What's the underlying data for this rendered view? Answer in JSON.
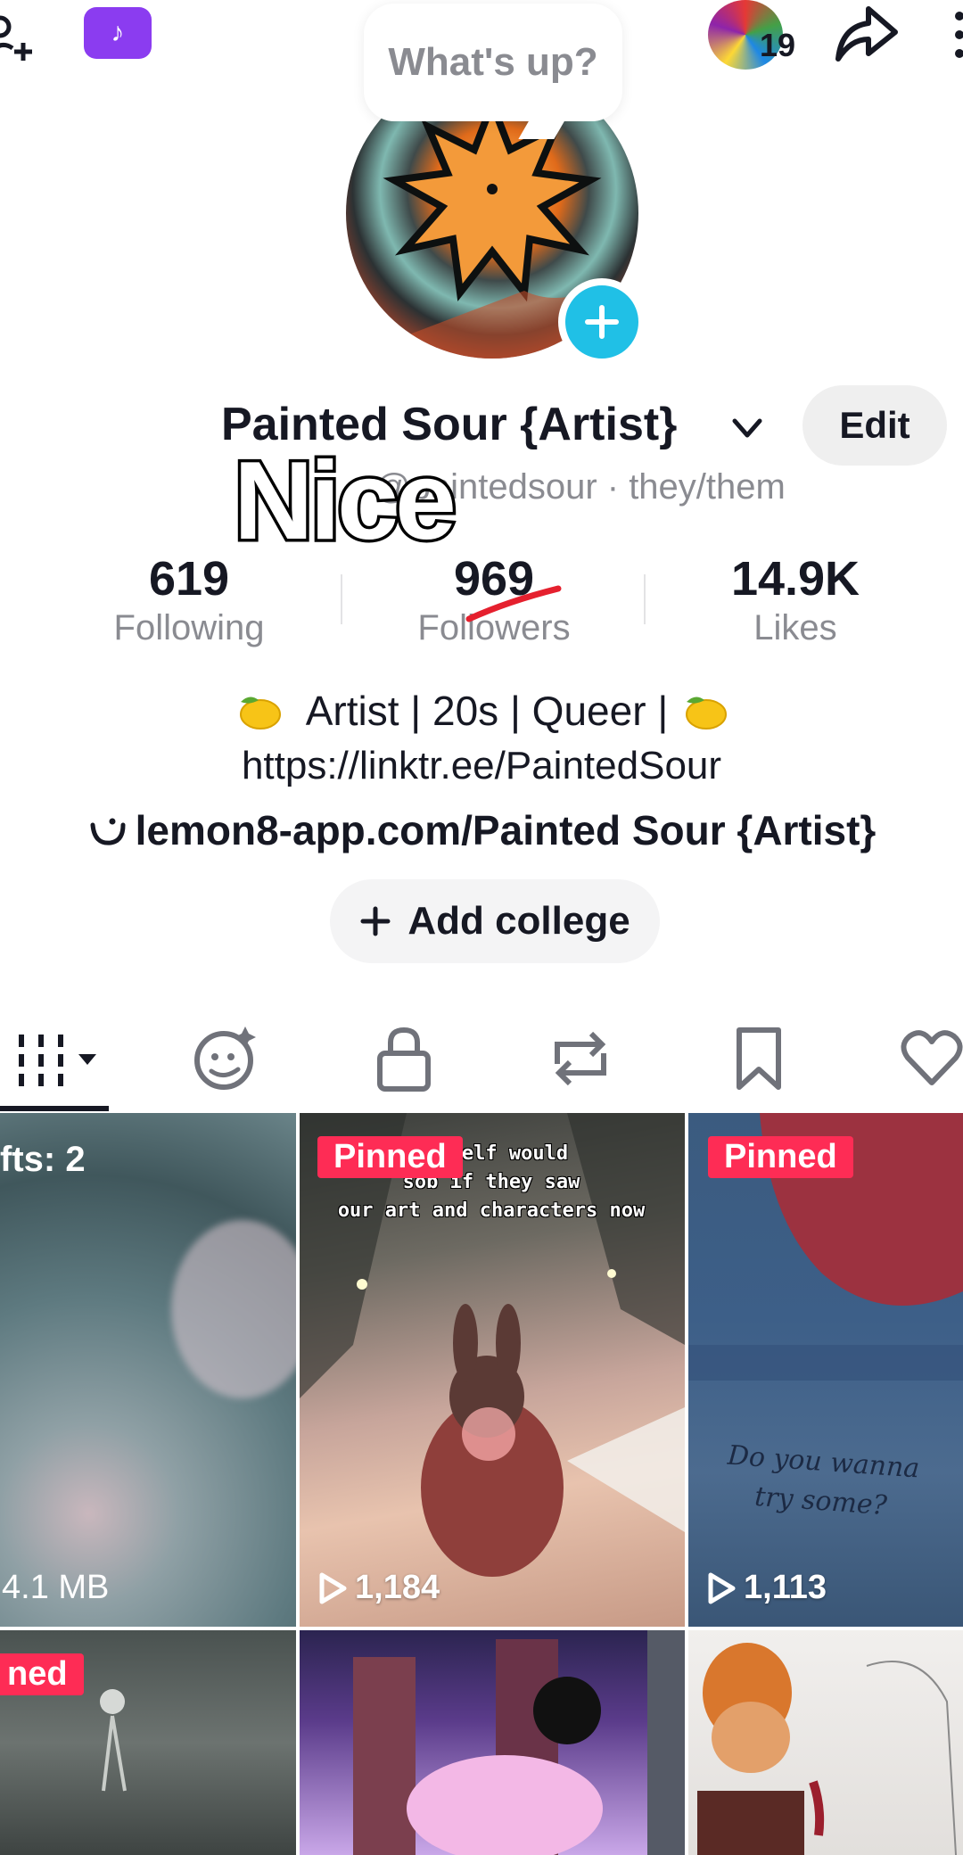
{
  "top_bar": {
    "whats_up": "What's up?",
    "story_count": "19"
  },
  "profile": {
    "display_name": "Painted Sour {Artist}",
    "handle_line": "@paintedsour · they/them",
    "edit_label": "Edit",
    "overlay_caption": "Nice"
  },
  "stats": [
    {
      "value": "619",
      "label": "Following"
    },
    {
      "value": "969",
      "label": "Followers"
    },
    {
      "value": "14.9K",
      "label": "Likes"
    }
  ],
  "bio": {
    "line1": "Artist | 20s | Queer |",
    "link": "https://linktr.ee/PaintedSour",
    "lemon8": "lemon8-app.com/Painted Sour {Artist}"
  },
  "add_college_label": "Add college",
  "tabs": [
    "videos-tab",
    "ai-self-tab",
    "private-tab",
    "reposts-tab",
    "favorites-tab",
    "liked-tab"
  ],
  "grid": {
    "drafts_label": "fts: 2",
    "drafts_size": "4.1 MB",
    "pinned_label": "Pinned",
    "pinned_partial": "ned",
    "video2_caption": "er self would\nsob if they saw\nour art and characters now",
    "video2_views": "1,184",
    "video3_views": "1,113",
    "video3_note": "Do you wanna try some?"
  },
  "colors": {
    "accent_red": "#fe2c55",
    "avatar_plus": "#20c0e6",
    "badge_purple": "#8b3cf0",
    "text_primary": "#161823",
    "text_secondary": "#8a8b91"
  }
}
